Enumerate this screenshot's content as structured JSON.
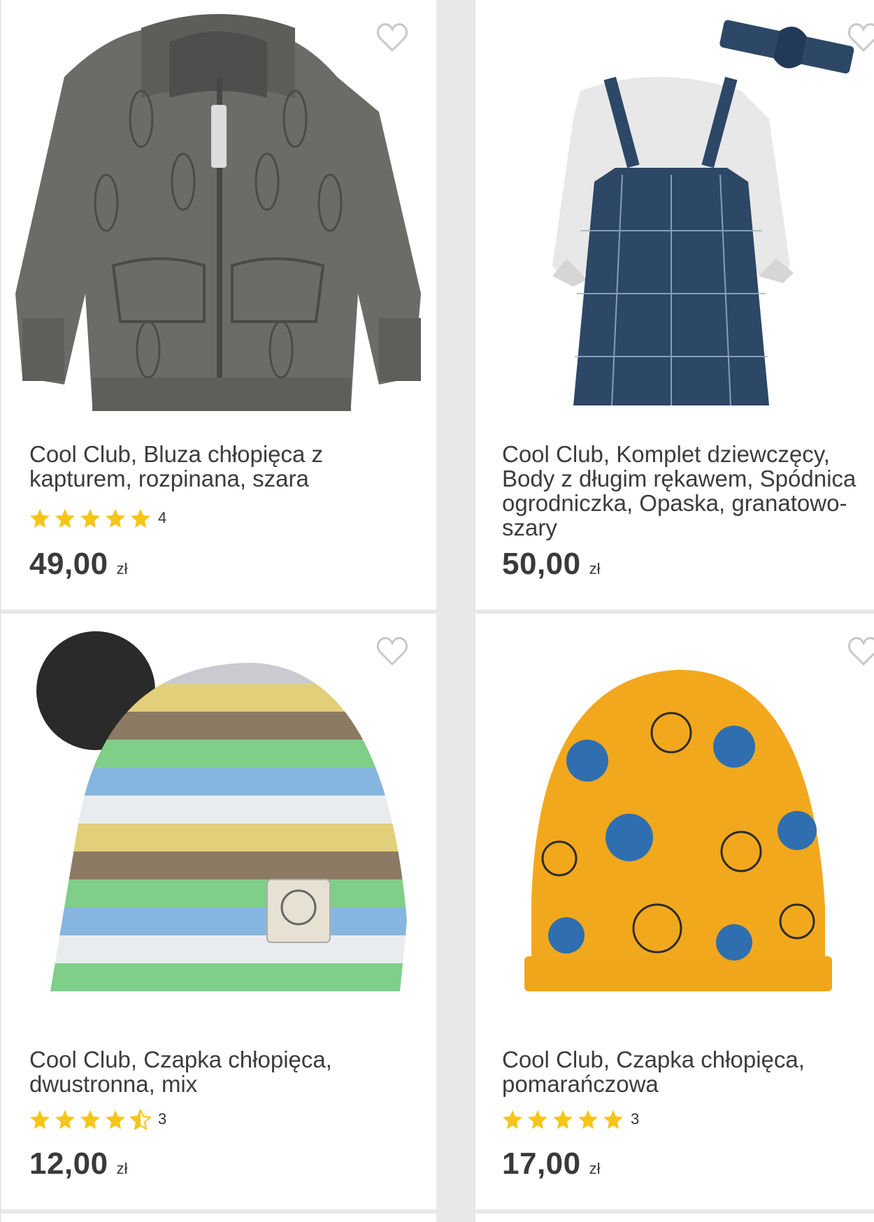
{
  "products": [
    {
      "title": "Cool Club, Bluza chłopięca z kapturem, rozpinana, szara",
      "rating_count": "4",
      "rating_stars": 5,
      "price": "49,00",
      "currency": "zł"
    },
    {
      "title": "Cool Club, Komplet dziewczęcy, Body z długim rękawem, Spódnica ogrodniczka, Opaska, granatowo-szary",
      "price": "50,00",
      "currency": "zł"
    },
    {
      "title": "Cool Club, Czapka chłopięca, dwustronna, mix",
      "rating_count": "3",
      "rating_stars": 4.5,
      "price": "12,00",
      "currency": "zł"
    },
    {
      "title": "Cool Club, Czapka chłopięca, pomarańczowa",
      "rating_count": "3",
      "rating_stars": 5,
      "price": "17,00",
      "currency": "zł"
    }
  ],
  "icons": {
    "favorite": "heart-outline-icon",
    "star": "star-icon",
    "star_half": "star-half-icon"
  },
  "colors": {
    "star": "#f5c518",
    "price": "#3a3a3a",
    "heart": "#c8c8c8"
  }
}
